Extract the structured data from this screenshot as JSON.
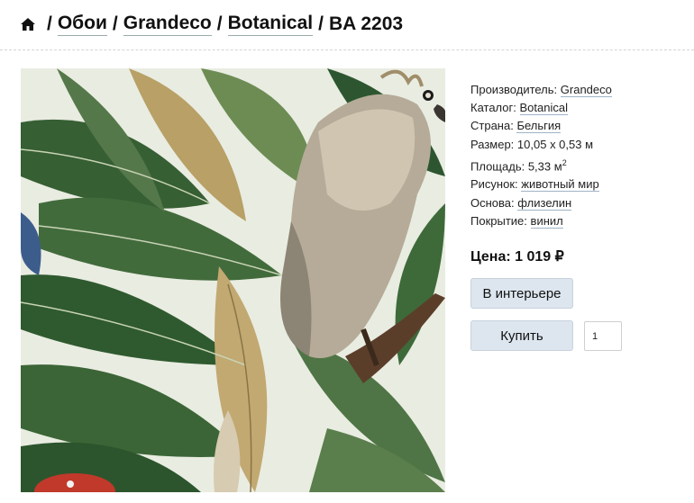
{
  "breadcrumb": {
    "home_icon": "home-icon",
    "separator": "/",
    "items": [
      "Обои",
      "Grandeco",
      "Botanical"
    ],
    "current": "BA 2203"
  },
  "product": {
    "image_alt_icon": "wallpaper-image",
    "properties": [
      {
        "label": "Производитель:",
        "value": "Grandeco",
        "link": true
      },
      {
        "label": "Каталог:",
        "value": "Botanical",
        "link": true
      },
      {
        "label": "Страна:",
        "value": "Бельгия",
        "link": true
      },
      {
        "label": "Размер:",
        "value": "10,05 х 0,53 м",
        "link": false
      },
      {
        "label": "Площадь:",
        "value": "5,33 м",
        "sup": "2",
        "link": false
      },
      {
        "label": "Рисунок:",
        "value": "животный мир",
        "link": true
      },
      {
        "label": "Основа:",
        "value": "флизелин",
        "link": true
      },
      {
        "label": "Покрытие:",
        "value": "винил",
        "link": true
      }
    ],
    "price_label": "Цена: 1 019 ₽",
    "interior_button": "В интерьере",
    "buy_button": "Купить",
    "quantity": "1"
  },
  "colors": {
    "button_bg": "#dde6ef",
    "link_underline": "#9fb3c6",
    "leaf_dark": "#2f5a30",
    "leaf_light": "#b59a5c"
  }
}
